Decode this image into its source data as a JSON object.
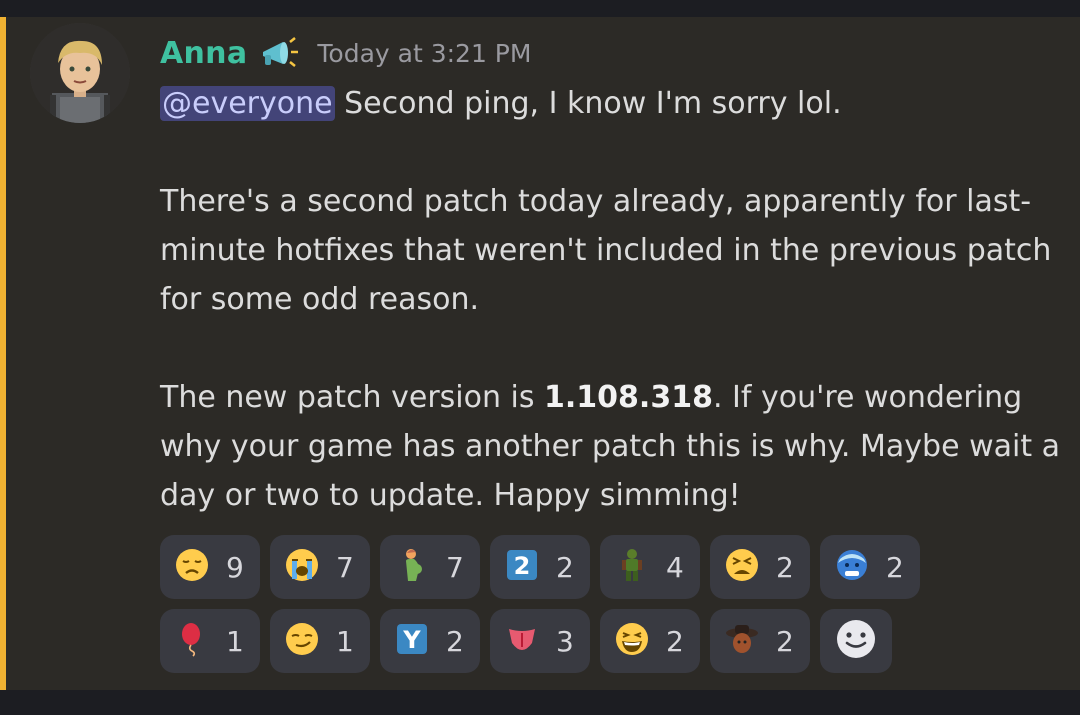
{
  "message": {
    "author": "Anna",
    "author_color": "#3fc1a0",
    "role_icon": "megaphone-icon",
    "timestamp": "Today at 3:21 PM",
    "mention": "@everyone",
    "line1_rest": " Second ping, I know I'm sorry lol.",
    "paragraph2": "There's a second patch today already, apparently for last-minute hotfixes that weren't included in the previous patch for some odd reason.",
    "p3_before": "The new patch version is ",
    "p3_bold": "1.108.318",
    "p3_after": ". If you're wondering why your game has another patch this is why. Maybe wait a day or two to update. Happy simming!"
  },
  "reactions": [
    {
      "emoji": "disappointed-face-icon",
      "count": "9"
    },
    {
      "emoji": "loudly-crying-face-icon",
      "count": "7"
    },
    {
      "emoji": "pregnant-person-icon",
      "count": "7"
    },
    {
      "emoji": "keycap-2-icon",
      "count": "2"
    },
    {
      "emoji": "green-creature-icon",
      "count": "4"
    },
    {
      "emoji": "tired-face-icon",
      "count": "2"
    },
    {
      "emoji": "cold-face-icon",
      "count": "2"
    },
    {
      "emoji": "balloon-icon",
      "count": "1"
    },
    {
      "emoji": "smirking-face-icon",
      "count": "1"
    },
    {
      "emoji": "letter-y-icon",
      "count": "2"
    },
    {
      "emoji": "tongue-icon",
      "count": "3"
    },
    {
      "emoji": "laughing-face-icon",
      "count": "2"
    },
    {
      "emoji": "cowboy-character-icon",
      "count": "2"
    }
  ],
  "add_reaction": "add-reaction-icon",
  "colors": {
    "background": "#2c2a26",
    "mention_bar": "#f0b232",
    "mention_bg": "#434478",
    "reaction_bg": "#393a41"
  }
}
